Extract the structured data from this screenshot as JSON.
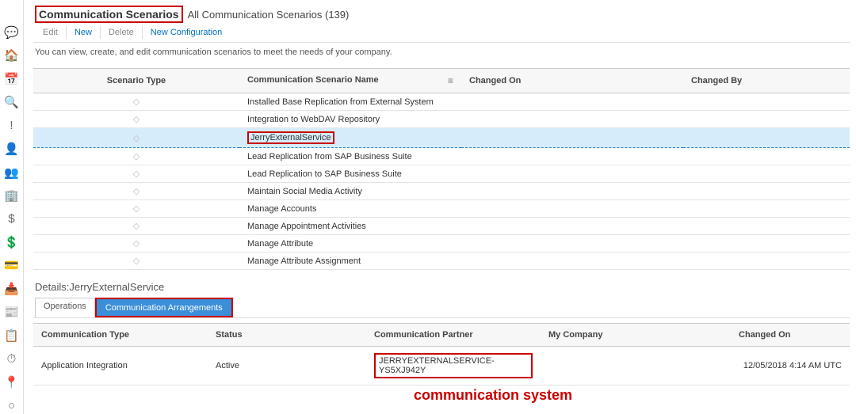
{
  "header": {
    "title": "Communication Scenarios",
    "subtitle": "All Communication Scenarios (139)"
  },
  "toolbar": {
    "edit": "Edit",
    "new": "New",
    "delete": "Delete",
    "new_config": "New Configuration"
  },
  "help_text": "You can view, create, and edit communication scenarios to meet the needs of your company.",
  "columns": {
    "scenario_type": "Scenario Type",
    "scenario_name": "Communication Scenario Name",
    "changed_on": "Changed On",
    "changed_by": "Changed By"
  },
  "rows": [
    {
      "type_glyph": "◇",
      "name": "Installed Base Replication from External System",
      "changed_on": "",
      "changed_by": ""
    },
    {
      "type_glyph": "◇",
      "name": "Integration to WebDAV Repository",
      "changed_on": "",
      "changed_by": ""
    },
    {
      "type_glyph": "◇",
      "name": "JerryExternalService",
      "changed_on": "",
      "changed_by": ""
    },
    {
      "type_glyph": "◇",
      "name": "Lead Replication from SAP Business Suite",
      "changed_on": "",
      "changed_by": ""
    },
    {
      "type_glyph": "◇",
      "name": "Lead Replication to SAP Business Suite",
      "changed_on": "",
      "changed_by": ""
    },
    {
      "type_glyph": "◇",
      "name": "Maintain Social Media Activity",
      "changed_on": "",
      "changed_by": ""
    },
    {
      "type_glyph": "◇",
      "name": "Manage Accounts",
      "changed_on": "",
      "changed_by": ""
    },
    {
      "type_glyph": "◇",
      "name": "Manage Appointment Activities",
      "changed_on": "",
      "changed_by": ""
    },
    {
      "type_glyph": "◇",
      "name": "Manage Attribute",
      "changed_on": "",
      "changed_by": ""
    },
    {
      "type_glyph": "◇",
      "name": "Manage Attribute Assignment",
      "changed_on": "",
      "changed_by": ""
    }
  ],
  "details": {
    "title": "Details:JerryExternalService",
    "tabs": {
      "operations": "Operations",
      "arrangements": "Communication Arrangements"
    }
  },
  "arr_columns": {
    "type": "Communication Type",
    "status": "Status",
    "partner": "Communication Partner",
    "company": "My Company",
    "changed_on": "Changed On"
  },
  "arr_row": {
    "type": "Application Integration",
    "status": "Active",
    "partner": "JERRYEXTERNALSERVICE-YS5XJ942Y",
    "company": "",
    "changed_on": "12/05/2018 4:14 AM UTC"
  },
  "annotation": "communication system",
  "sidebar_icons": [
    "chat-icon",
    "home-icon",
    "calendar-icon",
    "search-icon",
    "alert-icon",
    "user-icon",
    "team-icon",
    "org-icon",
    "money-icon",
    "revenue-icon",
    "card-icon",
    "inbox-icon",
    "news-icon",
    "clipboard-icon",
    "gauge-icon",
    "pin-icon",
    "circle-icon"
  ],
  "sidebar_glyphs": [
    "💬",
    "🏠",
    "📅",
    "🔍",
    "!",
    "👤",
    "👥",
    "🏢",
    "$",
    "💲",
    "💳",
    "📥",
    "📰",
    "📋",
    "⏱",
    "📍",
    "○"
  ]
}
